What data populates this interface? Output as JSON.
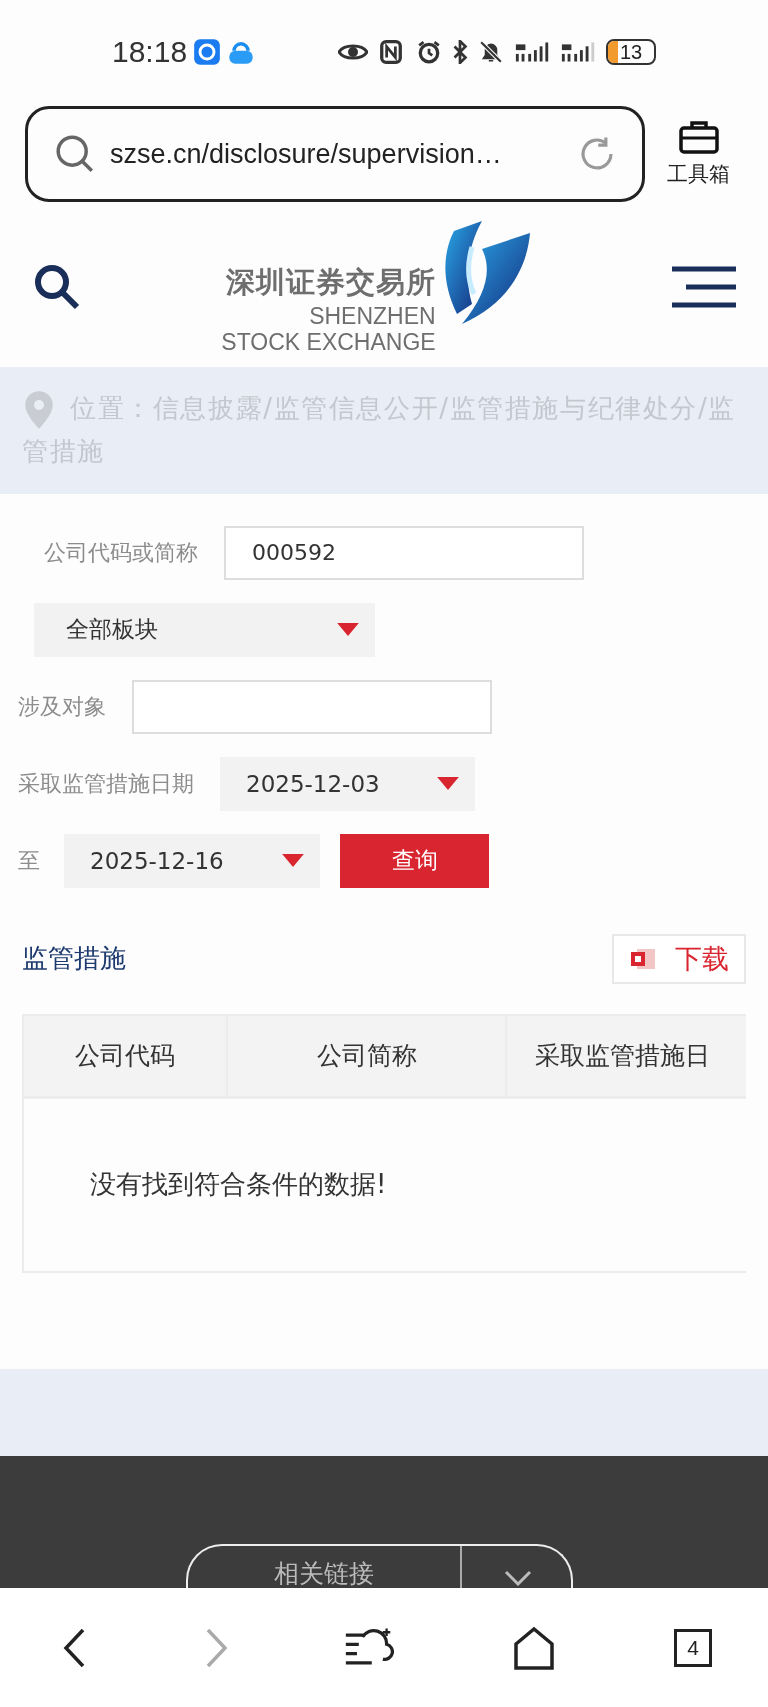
{
  "status_bar": {
    "time": "18:18",
    "battery": "13"
  },
  "browser": {
    "url": "szse.cn/disclosure/supervision…",
    "toolbox_label": "工具箱"
  },
  "site_header": {
    "logo_cn": "深圳证券交易所",
    "logo_en": [
      "SHENZHEN",
      "STOCK EXCHANGE"
    ]
  },
  "breadcrumb": "位置：信息披露/监管信息公开/监管措施与纪律处分/监管措施",
  "form": {
    "rows": [
      {
        "items": [
          {
            "kind": "label",
            "text": "公司代码或简称",
            "indent": true
          },
          {
            "kind": "input",
            "value": "000592"
          }
        ]
      },
      {
        "items": [
          {
            "kind": "select",
            "value": "全部板块"
          }
        ]
      },
      {
        "items": [
          {
            "kind": "label",
            "text": "涉及对象"
          },
          {
            "kind": "input",
            "value": ""
          }
        ]
      },
      {
        "items": [
          {
            "kind": "label",
            "text": "采取监管措施日期"
          },
          {
            "kind": "date",
            "value": "2025-12-03"
          }
        ]
      },
      {
        "items": [
          {
            "kind": "label",
            "text": "至"
          },
          {
            "kind": "date",
            "value": "2025-12-16"
          },
          {
            "kind": "button",
            "text": "查询"
          }
        ]
      }
    ]
  },
  "results": {
    "title": "监管措施",
    "download_label": "下载",
    "table": {
      "columns": [
        "公司代码",
        "公司简称",
        "采取监管措施日"
      ],
      "empty_message": "没有找到符合条件的数据!"
    }
  },
  "footer": {
    "links_label": "相关链接"
  },
  "bottom_nav": {
    "back_disabled": false,
    "forward_disabled": true,
    "tab_count": "4"
  }
}
